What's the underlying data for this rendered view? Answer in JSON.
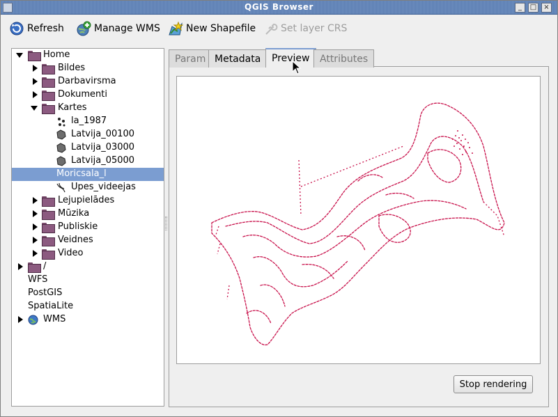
{
  "window": {
    "title": "QGIS Browser"
  },
  "toolbar": {
    "refresh": "Refresh",
    "manage_wms": "Manage WMS",
    "new_shapefile": "New Shapefile",
    "set_layer_crs": "Set layer CRS"
  },
  "tree": {
    "home": "Home",
    "bildes": "Bildes",
    "darbavirsma": "Darbavirsma",
    "dokumenti": "Dokumenti",
    "kartes": "Kartes",
    "la_1987": "la_1987",
    "latvija_00100": "Latvija_00100",
    "latvija_03000": "Latvija_03000",
    "latvija_05000": "Latvija_05000",
    "moricsala": "Moricsala_l",
    "upes": "Upes_videejas",
    "lejupielades": "Lejupielādes",
    "muzika": "Mūzika",
    "publiskie": "Publiskie",
    "veidnes": "Veidnes",
    "video": "Video",
    "root": "/",
    "wfs": "WFS",
    "postgis": "PostGIS",
    "spatialite": "SpatiaLite",
    "wms": "WMS"
  },
  "tabs": {
    "param": "Param",
    "metadata": "Metadata",
    "preview": "Preview",
    "attributes": "Attributes"
  },
  "buttons": {
    "stop_rendering": "Stop rendering"
  },
  "colors": {
    "map_stroke": "#c8104a",
    "selection": "#7b9dd1",
    "titlebar": "#5b7db2"
  }
}
